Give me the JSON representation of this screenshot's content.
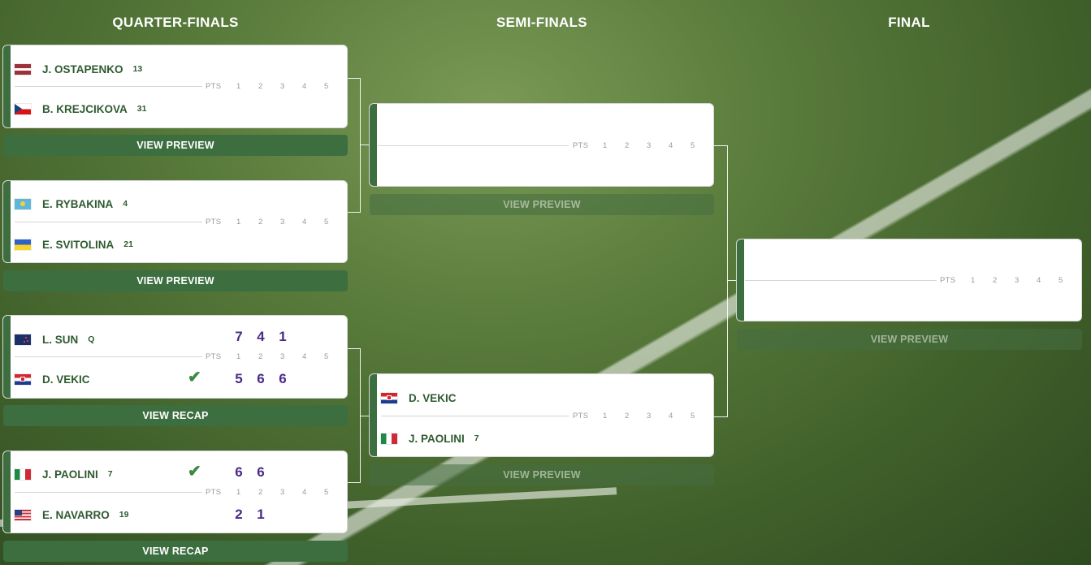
{
  "rounds": {
    "qf": "QUARTER-FINALS",
    "sf": "SEMI-FINALS",
    "final": "FINAL"
  },
  "score_header": {
    "pts": "PTS",
    "sets": [
      "1",
      "2",
      "3",
      "4",
      "5"
    ]
  },
  "qf": [
    {
      "p1": {
        "name": "J. OSTAPENKO",
        "seed": "13",
        "flag": "latvia-flag"
      },
      "p2": {
        "name": "B. KREJCIKOVA",
        "seed": "31",
        "flag": "czech-flag"
      },
      "button": "VIEW PREVIEW"
    },
    {
      "p1": {
        "name": "E. RYBAKINA",
        "seed": "4",
        "flag": "kazakhstan-flag"
      },
      "p2": {
        "name": "E. SVITOLINA",
        "seed": "21",
        "flag": "ukraine-flag"
      },
      "button": "VIEW PREVIEW"
    },
    {
      "p1": {
        "name": "L. SUN",
        "seed": "Q",
        "flag": "new-zealand-flag",
        "scores": [
          "7",
          "4",
          "1"
        ]
      },
      "p2": {
        "name": "D. VEKIC",
        "seed": "",
        "flag": "croatia-flag",
        "scores": [
          "5",
          "6",
          "6"
        ],
        "winner": true
      },
      "button": "VIEW RECAP"
    },
    {
      "p1": {
        "name": "J. PAOLINI",
        "seed": "7",
        "flag": "italy-flag",
        "scores": [
          "6",
          "6"
        ],
        "winner": true
      },
      "p2": {
        "name": "E. NAVARRO",
        "seed": "19",
        "flag": "usa-flag",
        "scores": [
          "2",
          "1"
        ]
      },
      "button": "VIEW RECAP"
    }
  ],
  "sf": [
    {
      "button": "VIEW PREVIEW"
    },
    {
      "p1": {
        "name": "D. VEKIC",
        "seed": "",
        "flag": "croatia-flag"
      },
      "p2": {
        "name": "J. PAOLINI",
        "seed": "7",
        "flag": "italy-flag"
      },
      "button": "VIEW PREVIEW"
    }
  ],
  "final": {
    "button": "VIEW PREVIEW"
  },
  "colors": {
    "accent": "#3c6e3f",
    "score": "#4b2a86",
    "check": "#3c8a3f"
  }
}
